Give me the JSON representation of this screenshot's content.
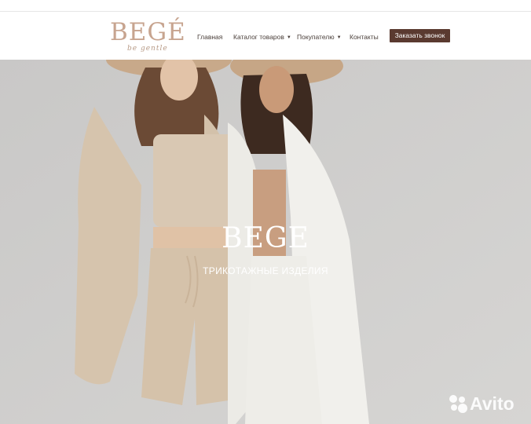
{
  "header": {
    "logo": {
      "word": "BEGÉ",
      "tagline": "be gentle"
    },
    "nav": [
      {
        "label": "Главная"
      },
      {
        "label": "Каталог товаров"
      },
      {
        "label": "Покупателю"
      },
      {
        "label": "Контакты"
      }
    ],
    "cta_label": "Заказать звонок"
  },
  "hero": {
    "title": "BEGE",
    "subtitle": "ТРИКОТАЖНЫЕ ИЗДЕЛИЯ"
  },
  "watermark": {
    "text": "Avito"
  },
  "colors": {
    "logo": "#c7a48f",
    "cta_bg": "#5a3a30",
    "hero_bg": "#cdcccb",
    "outfit_beige": "#d8c6b0",
    "outfit_white": "#f0eee9"
  },
  "icons": {
    "nav_chevron": "chevron-down-icon",
    "watermark_logo": "avito-logo-icon"
  }
}
